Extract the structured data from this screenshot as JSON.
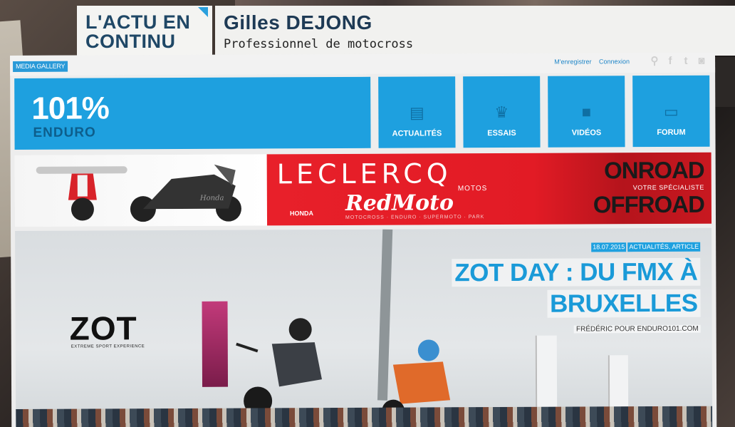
{
  "ticker": {
    "label_line1": "L'ACTU EN",
    "label_line2": "CONTINU",
    "name": "Gilles DEJONG",
    "subtitle": "Professionnel de motocross"
  },
  "site": {
    "media_gallery": "MEDIA GALLERY",
    "top_links": [
      "M'enregistrer",
      "Connexion"
    ],
    "social_icons": [
      "search-icon",
      "facebook-icon",
      "twitter-icon",
      "rss-icon"
    ],
    "logo": {
      "number": "101%",
      "word": "ENDURO"
    },
    "nav": [
      {
        "label": "ACTUALITÉS",
        "icon": "newspaper-icon"
      },
      {
        "label": "ESSAIS",
        "icon": "award-icon"
      },
      {
        "label": "VIDÉOS",
        "icon": "video-camera-icon"
      },
      {
        "label": "FORUM",
        "icon": "chat-icon"
      }
    ],
    "banner": {
      "brand": "LECLERCQ",
      "brand_sub": "MOTOS",
      "honda": "HONDA",
      "redmoto": "RedMoto",
      "redmoto_sub": "MOTOCROSS · ENDURO · SUPERMOTO · PARK",
      "onroad": "ONROAD",
      "votre": "VOTRE SPÉCIALISTE",
      "offroad": "OFFROAD",
      "signature": "Honda"
    },
    "hero": {
      "date": "18.07.2015",
      "tags": "ACTUALITÉS, ARTICLE",
      "title_line1": "ZOT DAY : DU FMX À",
      "title_line2": "BRUXELLES",
      "byline": "FRÉDÉRIC POUR ENDURO101.COM",
      "zot_logo": "ZOT",
      "zot_sub": "EXTREME SPORT EXPERIENCE"
    }
  },
  "colors": {
    "site_blue": "#1ea0df",
    "banner_red": "#e21b25",
    "ticker_navy": "#1f4766"
  }
}
